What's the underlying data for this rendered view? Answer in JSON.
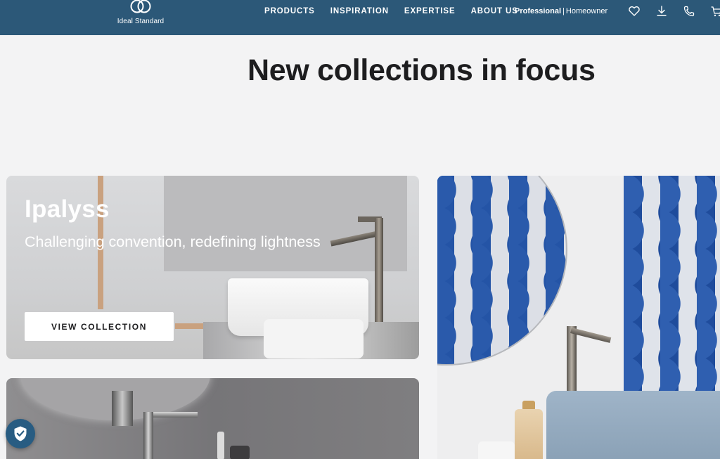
{
  "header": {
    "logo_text": "Ideal Standard",
    "nav": [
      "PRODUCTS",
      "INSPIRATION",
      "EXPERTISE",
      "ABOUT US"
    ],
    "audience": {
      "professional": "Professional",
      "separator": "|",
      "homeowner": "Homeowner"
    },
    "icons": [
      "heart-icon",
      "download-icon",
      "phone-icon",
      "cart-icon"
    ],
    "background": "#2c5878"
  },
  "main": {
    "title": "New collections in focus"
  },
  "cards": {
    "ipalyss": {
      "title": "Ipalyss",
      "subtitle": "Challenging convention, redefining lightness",
      "button": "VIEW COLLECTION"
    }
  },
  "privacy": {
    "icon": "shield-check-icon"
  }
}
